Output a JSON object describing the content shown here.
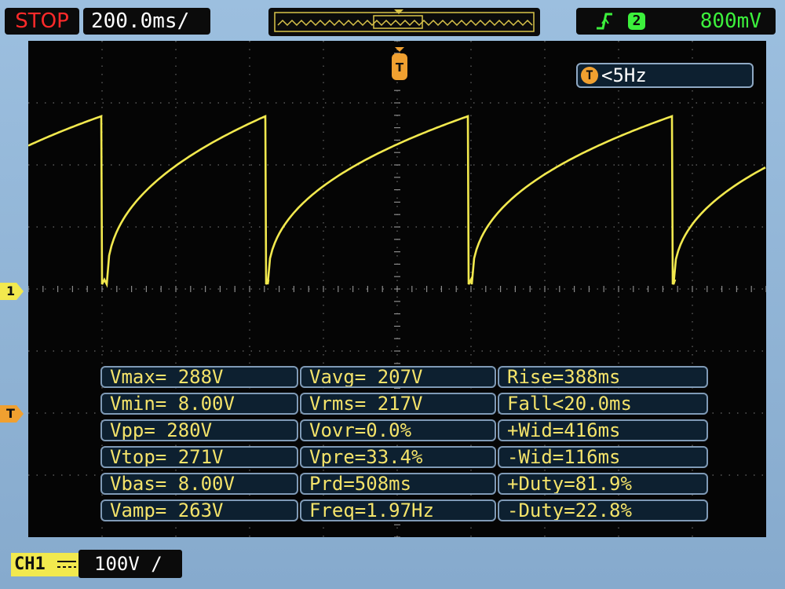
{
  "status": {
    "run_state": "STOP",
    "timebase": "200.0ms/"
  },
  "trigger": {
    "slope_icon": "rising-edge-icon",
    "source": "2",
    "level": "800mV",
    "freq_badge": "T",
    "freq": "<5Hz",
    "marker_label": "T"
  },
  "channel": {
    "marker_label": "1",
    "name": "CH1",
    "coupling_icon": "dc-coupling-icon",
    "scale": "100V",
    "probe_suffix": "/"
  },
  "measurements": {
    "col1": [
      "Vmax= 288V",
      "Vmin= 8.00V",
      "Vpp= 280V",
      "Vtop= 271V",
      "Vbas= 8.00V",
      "Vamp= 263V"
    ],
    "col2": [
      "Vavg= 207V",
      "Vrms= 217V",
      "Vovr=0.0%",
      "Vpre=33.4%",
      "Prd=508ms",
      "Freq=1.97Hz"
    ],
    "col3": [
      "Rise=388ms",
      "Fall<20.0ms",
      "+Wid=416ms",
      "-Wid=116ms",
      "+Duty=81.9%",
      "-Duty=22.8%"
    ]
  },
  "colors": {
    "trace": "#f2e94e",
    "stop": "#ff2a2a",
    "trigger_status": "#3cf03c",
    "measure_text": "#f4e36a",
    "trigger_marker": "#f0a030"
  }
}
